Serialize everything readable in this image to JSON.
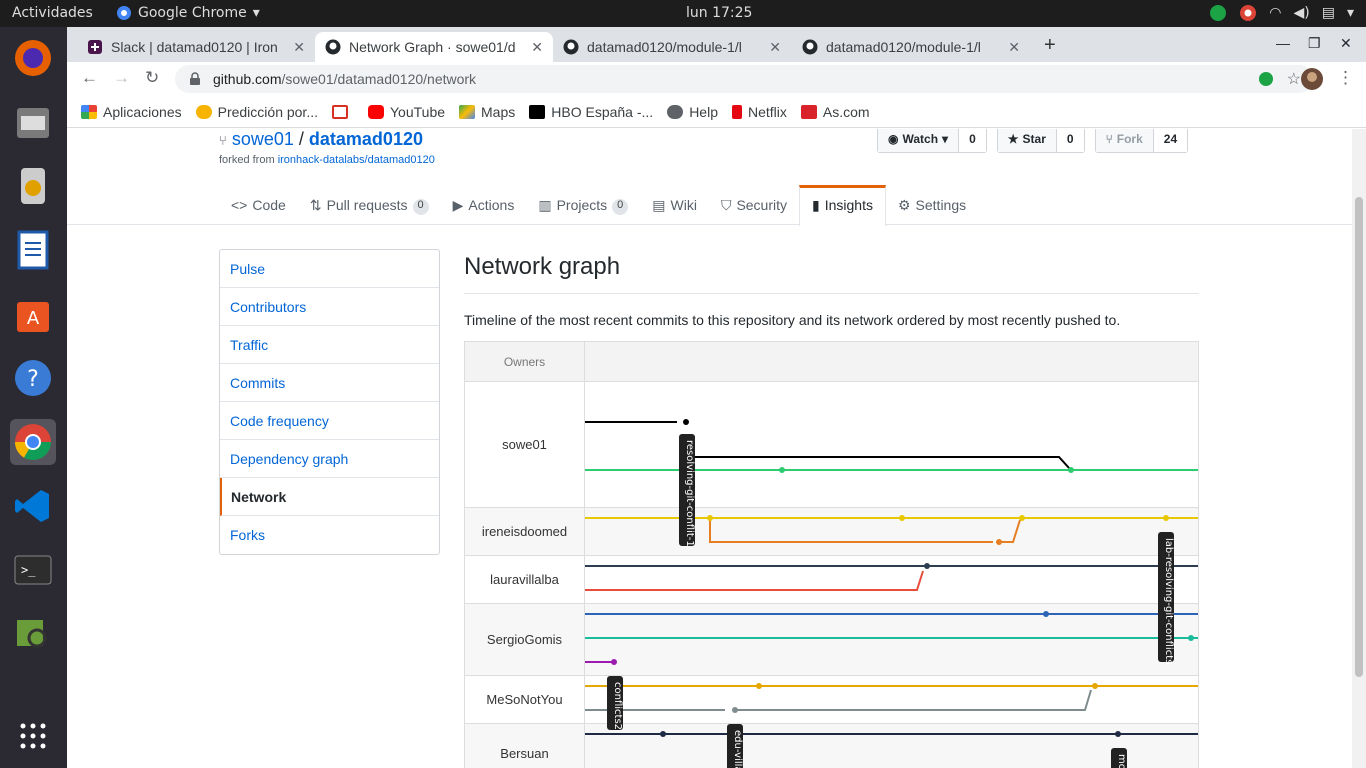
{
  "os": {
    "activities": "Actividades",
    "app_name": "Google Chrome",
    "clock": "lun 17:25"
  },
  "tabs": [
    {
      "title": "Slack | datamad0120 | Iron",
      "icon": "slack-icon",
      "active": false
    },
    {
      "title": "Network Graph · sowe01/d",
      "icon": "github-icon",
      "active": true
    },
    {
      "title": "datamad0120/module-1/l",
      "icon": "github-icon",
      "active": false
    },
    {
      "title": "datamad0120/module-1/l",
      "icon": "github-icon",
      "active": false
    }
  ],
  "address": {
    "host": "github.com",
    "path": "/sowe01/datamad0120/network"
  },
  "bookmarks": [
    {
      "label": "Aplicaciones",
      "icon": "apps-grid-icon",
      "color": "#e94235"
    },
    {
      "label": "Predicción por...",
      "icon": "weather-icon",
      "color": "#f6b400"
    },
    {
      "label": "",
      "icon": "gmail-icon",
      "color": "#d93025"
    },
    {
      "label": "YouTube",
      "icon": "youtube-icon",
      "color": "#ff0000"
    },
    {
      "label": "Maps",
      "icon": "maps-icon",
      "color": "#34a853"
    },
    {
      "label": "HBO España -...",
      "icon": "hbo-icon",
      "color": "#000000"
    },
    {
      "label": "Help",
      "icon": "help-globe-icon",
      "color": "#5f6368"
    },
    {
      "label": "Netflix",
      "icon": "netflix-icon",
      "color": "#e50914"
    },
    {
      "label": "As.com",
      "icon": "as-icon",
      "color": "#d8232a"
    }
  ],
  "repo": {
    "owner": "sowe01",
    "name": "datamad0120",
    "forked_prefix": "forked from",
    "forked_from": "ironhack-datalabs/datamad0120",
    "watch_label": "Watch",
    "watch_count": "0",
    "star_label": "Star",
    "star_count": "0",
    "fork_label": "Fork",
    "fork_count": "24"
  },
  "repo_nav": [
    {
      "label": "Code",
      "icon": "code-icon",
      "count": ""
    },
    {
      "label": "Pull requests",
      "icon": "pull-request-icon",
      "count": "0"
    },
    {
      "label": "Actions",
      "icon": "play-icon",
      "count": ""
    },
    {
      "label": "Projects",
      "icon": "project-icon",
      "count": "0"
    },
    {
      "label": "Wiki",
      "icon": "book-icon",
      "count": ""
    },
    {
      "label": "Security",
      "icon": "shield-icon",
      "count": ""
    },
    {
      "label": "Insights",
      "icon": "graph-icon",
      "count": "",
      "selected": true
    },
    {
      "label": "Settings",
      "icon": "gear-icon",
      "count": ""
    }
  ],
  "insights_menu": [
    "Pulse",
    "Contributors",
    "Traffic",
    "Commits",
    "Code frequency",
    "Dependency graph",
    "Network",
    "Forks"
  ],
  "insights_selected": "Network",
  "network": {
    "title": "Network graph",
    "description": "Timeline of the most recent commits to this repository and its network ordered by most recently pushed to.",
    "owners_header": "Owners",
    "owners": [
      "sowe01",
      "ireneisdoomed",
      "lauravillalba",
      "SergioGomis",
      "MeSoNotYou",
      "Bersuan"
    ],
    "branch_labels": [
      "resolving-git-conflit-1",
      "lab-resolving-git-conflicts",
      "conflicts2",
      "edu-villa",
      "mo"
    ],
    "colors": {
      "black": "#000000",
      "green": "#2ecc71",
      "yellow": "#e8c800",
      "orange": "#e67e22",
      "navy": "#2c3e50",
      "red": "#e74c3c",
      "blue": "#2e64b8",
      "teal": "#1abc9c",
      "purple": "#9b1bb0",
      "gold": "#e6a700",
      "gray": "#7f8c8d",
      "darkblue": "#1f2a44"
    }
  }
}
